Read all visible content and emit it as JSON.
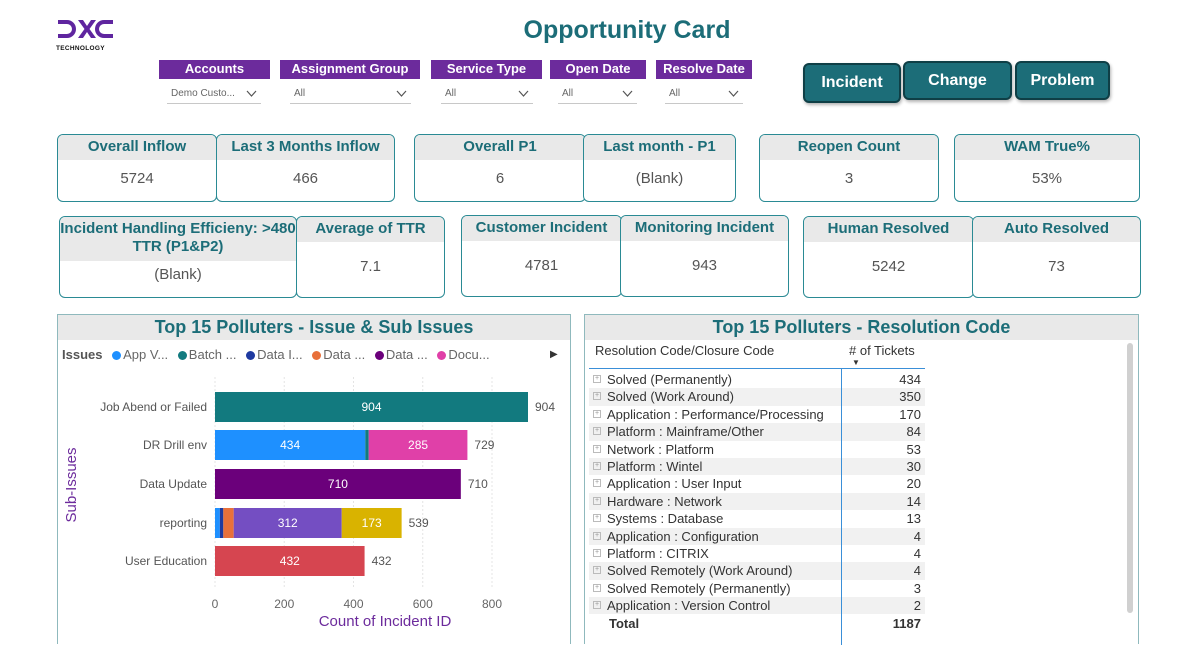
{
  "logo": {
    "text": "DXC",
    "subtitle": "TECHNOLOGY",
    "color": "#5f259f"
  },
  "page_title": "Opportunity Card",
  "slicers": [
    {
      "label": "Accounts",
      "value": "Demo Custo..."
    },
    {
      "label": "Assignment Group",
      "value": "All"
    },
    {
      "label": "Service Type",
      "value": "All"
    },
    {
      "label": "Open Date",
      "value": "All"
    },
    {
      "label": "Resolve Date",
      "value": "All"
    }
  ],
  "type_buttons": [
    "Incident",
    "Change",
    "Problem"
  ],
  "kpis": [
    {
      "label": "Overall Inflow",
      "value": "5724"
    },
    {
      "label": "Last 3 Months Inflow",
      "value": "466"
    },
    {
      "label": "Overall P1",
      "value": "6"
    },
    {
      "label": "Last month - P1",
      "value": "(Blank)"
    },
    {
      "label": "Reopen Count",
      "value": "3"
    },
    {
      "label": "WAM True%",
      "value": "53%"
    },
    {
      "label": "Incident Handling Efficieny: >480 TTR (P1&P2)",
      "value": "(Blank)"
    },
    {
      "label": "Average of TTR",
      "value": "7.1"
    },
    {
      "label": "Customer Incident",
      "value": "4781"
    },
    {
      "label": "Monitoring Incident",
      "value": "943"
    },
    {
      "label": "Human Resolved",
      "value": "5242"
    },
    {
      "label": "Auto Resolved",
      "value": "73"
    }
  ],
  "polluters_issue": {
    "title": "Top 15 Polluters - Issue & Sub Issues",
    "legend_title": "Issues",
    "legend_items": [
      {
        "label": "App V...",
        "color": "#1e90ff"
      },
      {
        "label": "Batch ...",
        "color": "#127a7f"
      },
      {
        "label": "Data I...",
        "color": "#1f3aa0"
      },
      {
        "label": "Data ...",
        "color": "#e8703a"
      },
      {
        "label": "Data ...",
        "color": "#6b007b"
      },
      {
        "label": "Docu...",
        "color": "#e040a8"
      }
    ]
  },
  "chart_data": {
    "type": "bar",
    "orientation": "horizontal",
    "stacked": true,
    "ylabel": "Sub-Issues",
    "xlabel": "Count of Incident ID",
    "xlim": [
      0,
      900
    ],
    "xticks": [
      0,
      200,
      400,
      600,
      800
    ],
    "categories": [
      "Job Abend or Failed",
      "DR Drill env",
      "Data Update",
      "reporting",
      "User Education"
    ],
    "totals": [
      904,
      729,
      710,
      539,
      432
    ],
    "segments": [
      [
        {
          "value": 904,
          "color": "#127a7f",
          "label": "904"
        }
      ],
      [
        {
          "value": 434,
          "color": "#1e90ff",
          "label": "434"
        },
        {
          "value": 10,
          "color": "#127a7f",
          "label": ""
        },
        {
          "value": 285,
          "color": "#e040a8",
          "label": "285"
        }
      ],
      [
        {
          "value": 710,
          "color": "#6b007b",
          "label": "710"
        }
      ],
      [
        {
          "value": 14,
          "color": "#1e90ff",
          "label": ""
        },
        {
          "value": 10,
          "color": "#1f3aa0",
          "label": ""
        },
        {
          "value": 30,
          "color": "#e8703a",
          "label": ""
        },
        {
          "value": 312,
          "color": "#744ec2",
          "label": "312"
        },
        {
          "value": 173,
          "color": "#d9b300",
          "label": "173"
        }
      ],
      [
        {
          "value": 432,
          "color": "#d64550",
          "label": "432"
        }
      ]
    ]
  },
  "resolution": {
    "title": "Top 15 Polluters - Resolution Code",
    "col_code": "Resolution Code/Closure Code",
    "col_count": "# of Tickets",
    "rows": [
      {
        "code": "Solved (Permanently)",
        "count": "434"
      },
      {
        "code": "Solved (Work Around)",
        "count": "350"
      },
      {
        "code": "Application : Performance/Processing",
        "count": "170"
      },
      {
        "code": "Platform : Mainframe/Other",
        "count": "84"
      },
      {
        "code": "Network : Platform",
        "count": "53"
      },
      {
        "code": "Platform : Wintel",
        "count": "30"
      },
      {
        "code": "Application : User Input",
        "count": "20"
      },
      {
        "code": "Hardware : Network",
        "count": "14"
      },
      {
        "code": "Systems : Database",
        "count": "13"
      },
      {
        "code": "Application : Configuration",
        "count": "4"
      },
      {
        "code": "Platform : CITRIX",
        "count": "4"
      },
      {
        "code": "Solved Remotely (Work Around)",
        "count": "4"
      },
      {
        "code": "Solved Remotely (Permanently)",
        "count": "3"
      },
      {
        "code": "Application : Version Control",
        "count": "2"
      }
    ],
    "total_label": "Total",
    "total_value": "1187"
  }
}
